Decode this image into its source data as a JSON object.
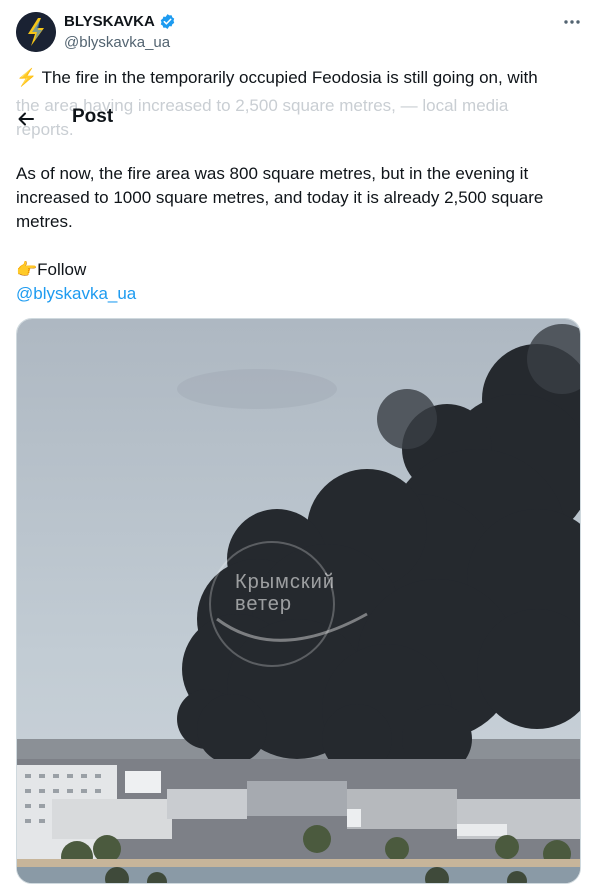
{
  "author": {
    "name": "BLYSKAVKA",
    "handle": "@blyskavka_ua",
    "verified_color": "#1d9bf0"
  },
  "header": {
    "title": "Post"
  },
  "tweet": {
    "first_line": "⚡ The fire in the temporarily occupied Feodosia is still going on, with",
    "faded_line1": "the area having increased to 2,500 square metres, — local media",
    "faded_line2": "reports.",
    "paragraph": "As of now, the fire area was 800 square metres, but in the evening it increased to 1000 square metres, and today it is already 2,500 square metres.",
    "follow_text": "👉Follow",
    "mention": "@blyskavka_ua"
  },
  "media": {
    "watermark_line1": "Крымский",
    "watermark_line2": "ветер"
  },
  "icons": {
    "back": "arrow-left-icon",
    "more": "more-icon",
    "verified": "verified-badge-icon"
  }
}
